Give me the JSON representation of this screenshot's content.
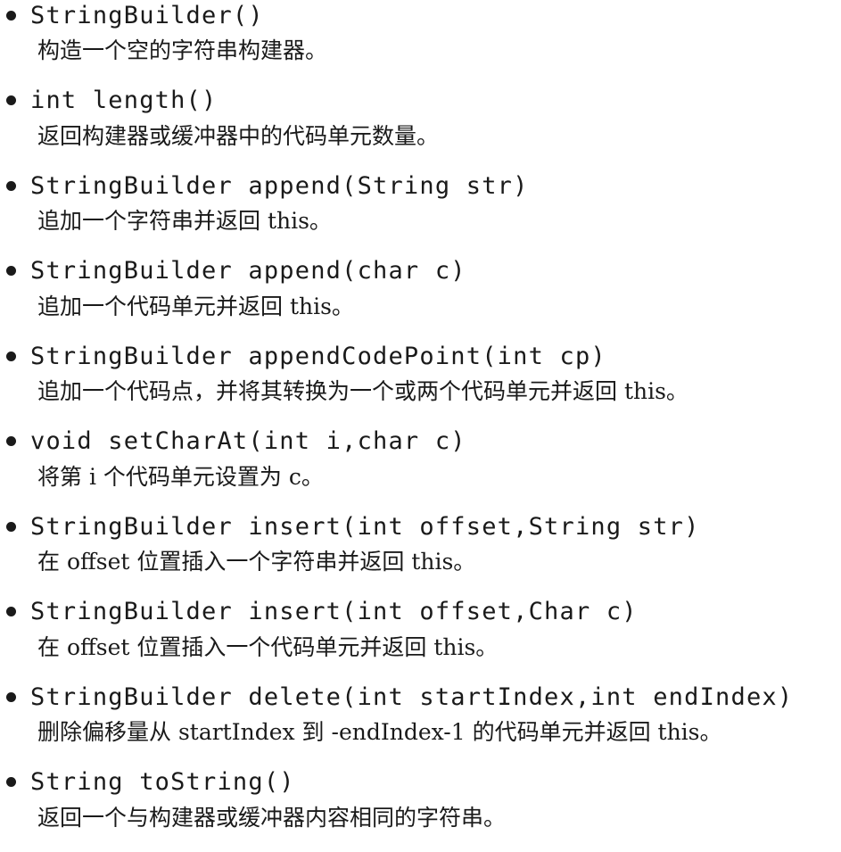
{
  "entries": [
    {
      "signature": "StringBuilder()",
      "description": "构造一个空的字符串构建器。"
    },
    {
      "signature": "int length()",
      "description": "返回构建器或缓冲器中的代码单元数量。"
    },
    {
      "signature": "StringBuilder append(String str)",
      "description": "追加一个字符串并返回 this。"
    },
    {
      "signature": "StringBuilder append(char c)",
      "description": "追加一个代码单元并返回 this。"
    },
    {
      "signature": "StringBuilder appendCodePoint(int cp)",
      "description": "追加一个代码点，并将其转换为一个或两个代码单元并返回 this。"
    },
    {
      "signature": "void setCharAt(int i,char c)",
      "description": "将第 i 个代码单元设置为 c。"
    },
    {
      "signature": "StringBuilder insert(int offset,String str)",
      "description": "在 offset 位置插入一个字符串并返回 this。"
    },
    {
      "signature": "StringBuilder insert(int offset,Char c)",
      "description": "在 offset 位置插入一个代码单元并返回 this。"
    },
    {
      "signature": "StringBuilder delete(int startIndex,int endIndex)",
      "description": "删除偏移量从 startIndex 到 -endIndex-1 的代码单元并返回 this。"
    },
    {
      "signature": "String toString()",
      "description": "返回一个与构建器或缓冲器内容相同的字符串。"
    }
  ]
}
